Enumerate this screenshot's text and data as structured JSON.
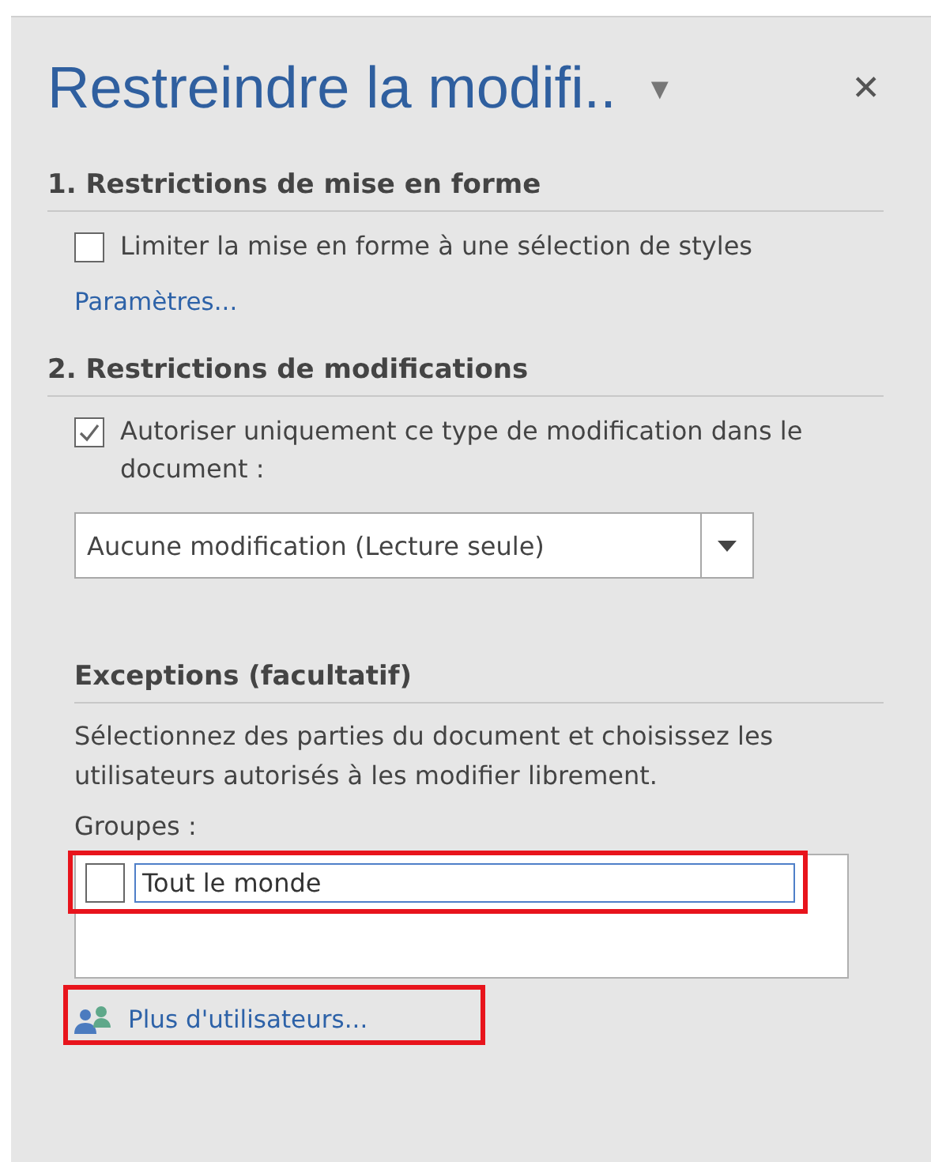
{
  "pane": {
    "title": "Restreindre la modifi..",
    "menu_caret": "▾",
    "close": "✕"
  },
  "formatting": {
    "heading": "1. Restrictions de mise en forme",
    "checkbox": {
      "label": "Limiter la mise en forme à une sélection de styles",
      "checked": false
    },
    "settings_link": "Paramètres..."
  },
  "editing": {
    "heading": "2. Restrictions de modifications",
    "checkbox": {
      "label": "Autoriser uniquement ce type de modification dans le document :",
      "checked": true
    },
    "dropdown": {
      "value": "Aucune modification (Lecture seule)"
    }
  },
  "exceptions": {
    "heading": "Exceptions (facultatif)",
    "description": "Sélectionnez des parties du document et choisissez les utilisateurs autorisés à les modifier librement.",
    "groups_label": "Groupes :",
    "groups": [
      {
        "name": "Tout le monde",
        "checked": false,
        "highlighted": true
      }
    ],
    "more_users": {
      "label": "Plus d'utilisateurs...",
      "highlighted": true
    }
  }
}
